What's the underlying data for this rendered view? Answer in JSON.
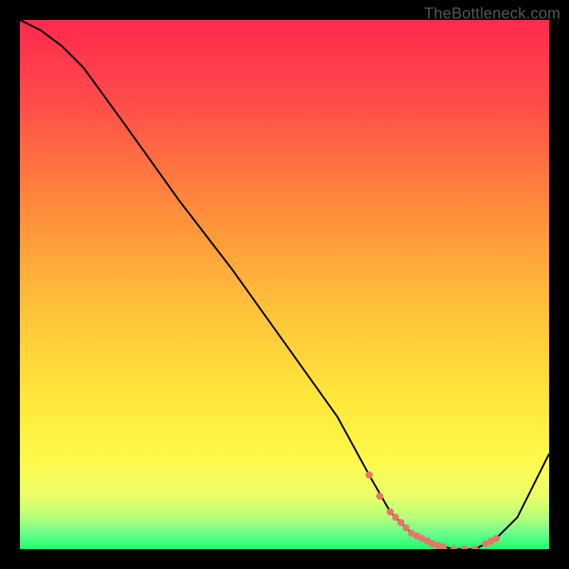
{
  "watermark": "TheBottleneck.com",
  "chart_data": {
    "type": "line",
    "title": "",
    "xlabel": "",
    "ylabel": "",
    "xlim": [
      0,
      100
    ],
    "ylim": [
      0,
      100
    ],
    "series": [
      {
        "name": "bottleneck-curve",
        "x": [
          0,
          4,
          8,
          12,
          20,
          30,
          40,
          50,
          60,
          66,
          70,
          74,
          78,
          82,
          86,
          90,
          94,
          100
        ],
        "y": [
          100,
          98,
          95,
          91,
          80,
          66,
          53,
          39,
          25,
          14,
          7,
          3,
          1,
          0,
          0,
          2,
          6,
          18
        ]
      }
    ],
    "highlight_segment": {
      "name": "optimal-range-markers",
      "x": [
        66,
        68,
        70,
        71,
        72,
        73,
        74,
        75,
        76,
        77,
        78,
        79,
        80,
        82,
        84,
        86,
        88,
        89,
        90
      ],
      "y": [
        14,
        10,
        7,
        6,
        5,
        4,
        3,
        2.5,
        2,
        1.5,
        1,
        0.7,
        0.4,
        0,
        0,
        0,
        1,
        1.5,
        2
      ]
    },
    "background_gradient": {
      "stops": [
        {
          "offset": 0.0,
          "color": "#ff2a4d"
        },
        {
          "offset": 0.15,
          "color": "#ff4a4a"
        },
        {
          "offset": 0.35,
          "color": "#ff8a3c"
        },
        {
          "offset": 0.55,
          "color": "#ffc23a"
        },
        {
          "offset": 0.72,
          "color": "#ffe83a"
        },
        {
          "offset": 0.83,
          "color": "#fff94a"
        },
        {
          "offset": 0.9,
          "color": "#eaff6a"
        },
        {
          "offset": 0.94,
          "color": "#b6ff7a"
        },
        {
          "offset": 0.97,
          "color": "#6aff8a"
        },
        {
          "offset": 1.0,
          "color": "#1aff6e"
        }
      ]
    }
  }
}
